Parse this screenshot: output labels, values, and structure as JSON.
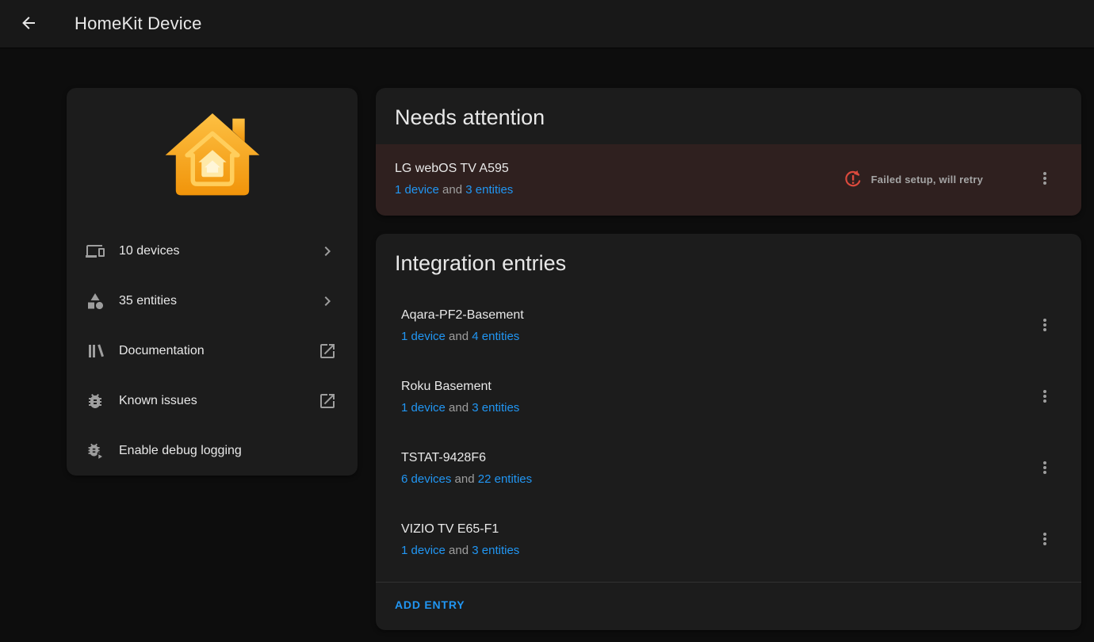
{
  "header": {
    "title": "HomeKit Device"
  },
  "colors": {
    "accent_blue": "#2196f3",
    "error_red": "#dc4a3d",
    "homekit_orange": "#f5a623",
    "card_bg": "#1c1c1c",
    "page_bg": "#0d0d0d",
    "attention_row_bg": "rgba(219,68,55,0.10)"
  },
  "overview_card": {
    "logo_icon": "homekit-house-icon",
    "items": [
      {
        "label": "10 devices",
        "icon": "devices-icon",
        "trailing_icon": "chevron-right-icon"
      },
      {
        "label": "35 entities",
        "icon": "shapes-icon",
        "trailing_icon": "chevron-right-icon"
      },
      {
        "label": "Documentation",
        "icon": "bookshelf-icon",
        "trailing_icon": "open-in-new-icon"
      },
      {
        "label": "Known issues",
        "icon": "bug-icon",
        "trailing_icon": "open-in-new-icon"
      },
      {
        "label": "Enable debug logging",
        "icon": "bug-play-icon",
        "trailing_icon": ""
      }
    ]
  },
  "needs_attention": {
    "title": "Needs attention",
    "entry": {
      "name": "LG webOS TV A595",
      "devices_link": "1 device",
      "conjunction": "and",
      "entities_link": "3 entities",
      "status": "Failed setup, will retry",
      "status_icon": "reload-alert-icon"
    }
  },
  "integration_entries": {
    "title": "Integration entries",
    "entries": [
      {
        "name": "Aqara-PF2-Basement",
        "devices_link": "1 device",
        "conjunction": "and",
        "entities_link": "4 entities"
      },
      {
        "name": "Roku Basement",
        "devices_link": "1 device",
        "conjunction": "and",
        "entities_link": "3 entities"
      },
      {
        "name": "TSTAT-9428F6",
        "devices_link": "6 devices",
        "conjunction": "and",
        "entities_link": "22 entities"
      },
      {
        "name": "VIZIO TV E65-F1",
        "devices_link": "1 device",
        "conjunction": "and",
        "entities_link": "3 entities"
      }
    ],
    "add_entry_label": "ADD ENTRY"
  }
}
